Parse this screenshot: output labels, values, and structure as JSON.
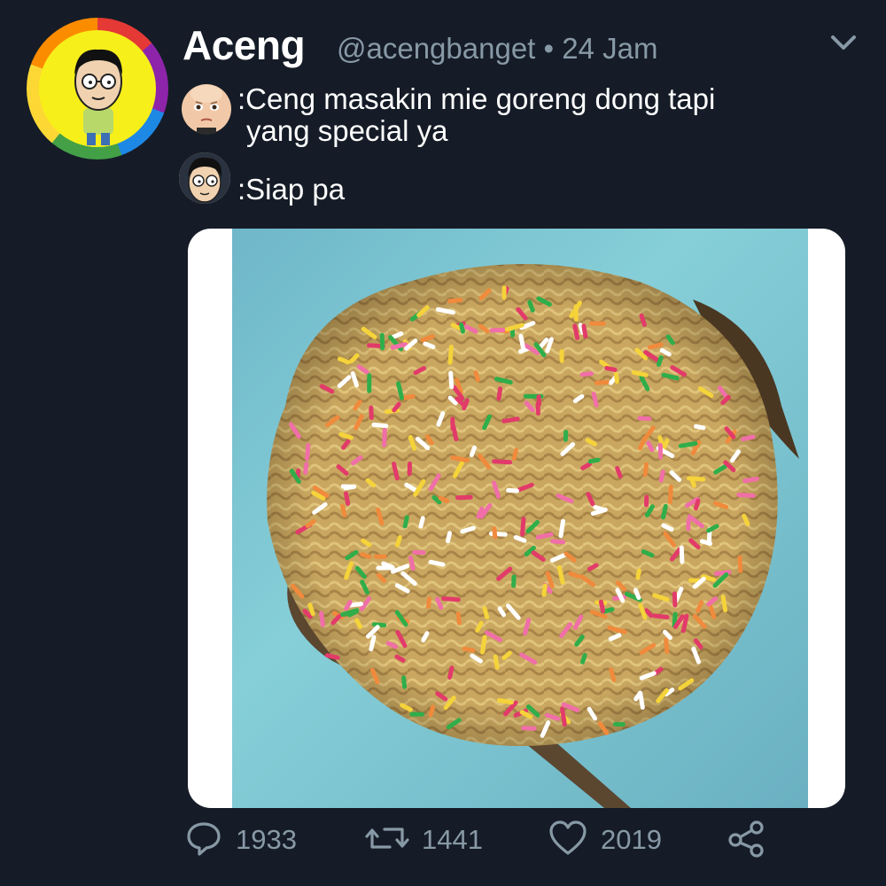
{
  "tweet": {
    "author_name": "Aceng",
    "handle": "@acengbanget",
    "separator": "•",
    "time": "24 Jam",
    "lines": [
      {
        "text_1": ":Ceng masakin mie goreng dong tapi",
        "text_2": "yang special ya"
      },
      {
        "text_1": ":Siap pa"
      }
    ]
  },
  "actions": {
    "reply_count": "1933",
    "retweet_count": "1441",
    "like_count": "2019"
  },
  "icons": {
    "reply": "comment-bubble-icon",
    "retweet": "retweet-icon",
    "like": "heart-icon",
    "share": "share-icon",
    "menu": "chevron-down-icon"
  },
  "colors": {
    "background": "#151c27",
    "muted_text": "#8899a6",
    "name_text": "#ffffff"
  }
}
